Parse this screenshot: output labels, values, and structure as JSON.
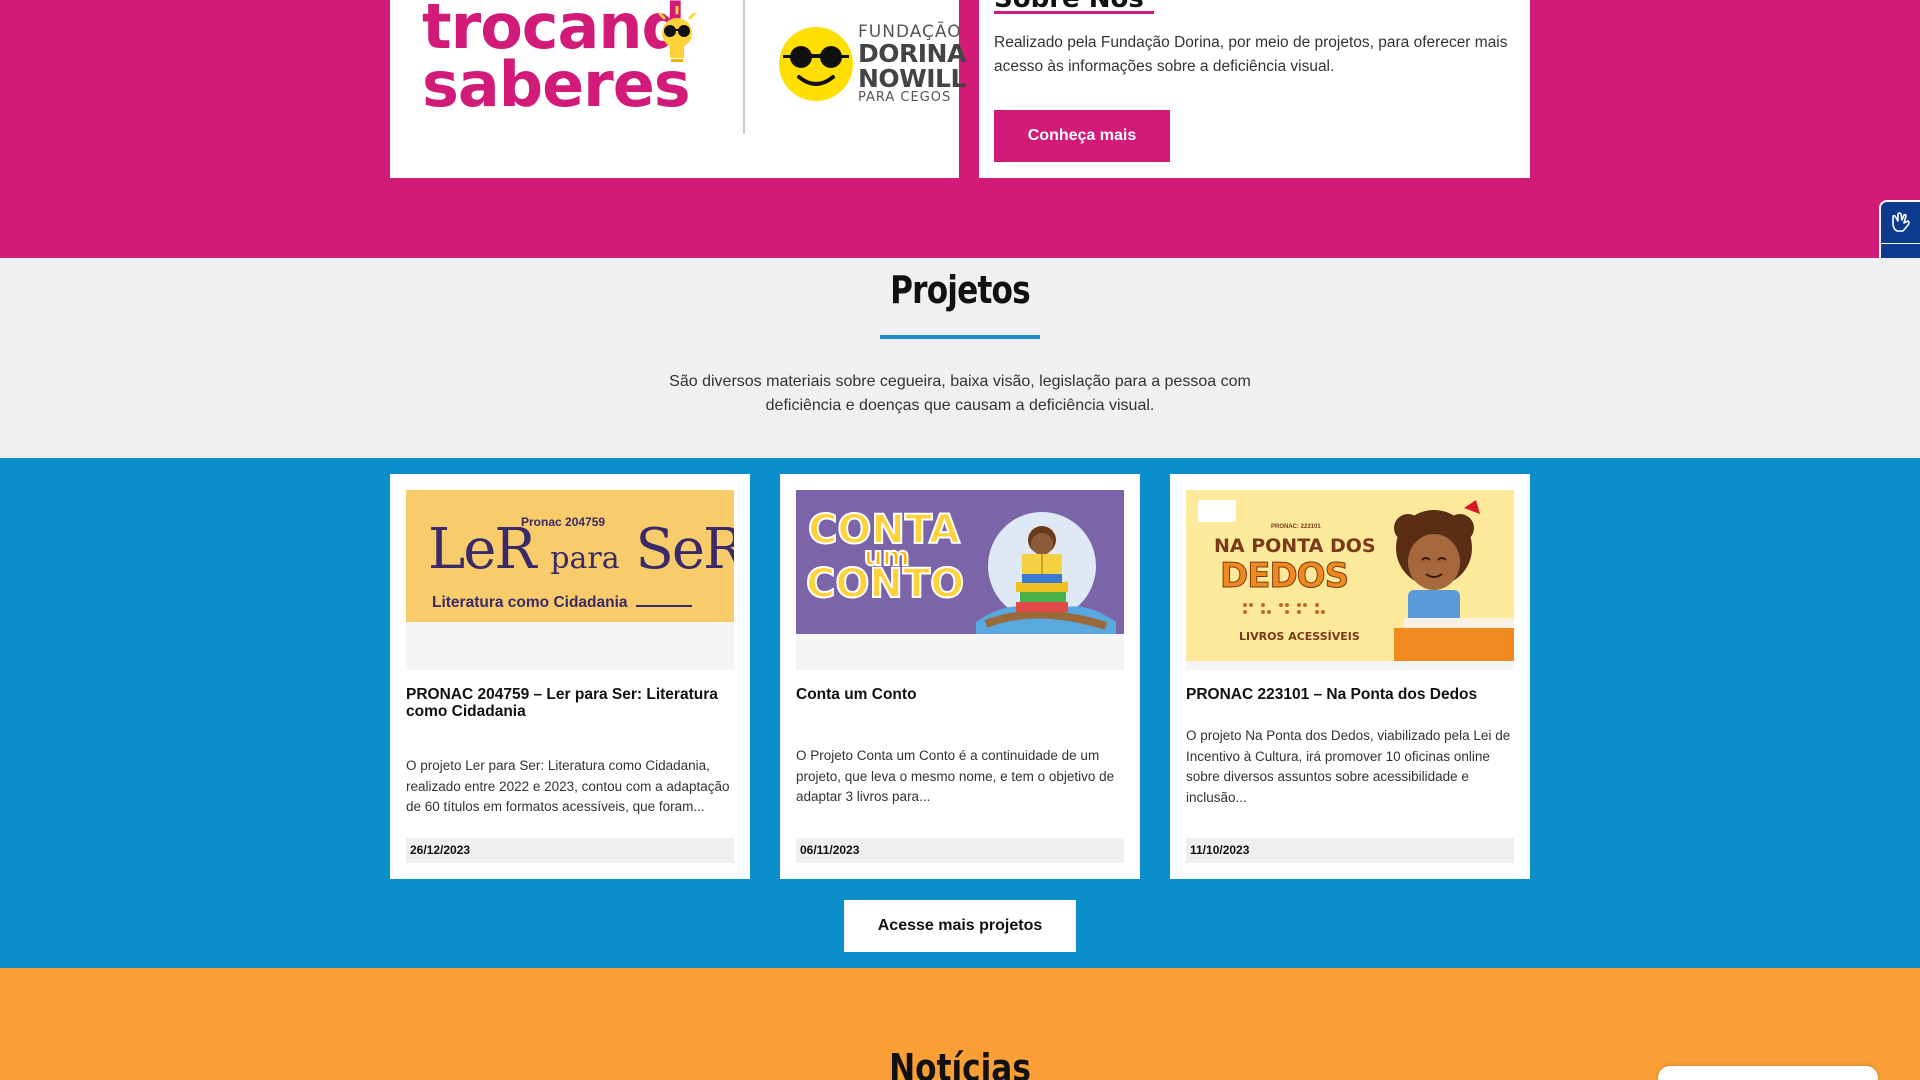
{
  "about": {
    "logo_line1": "trocand",
    "logo_line2": "saberes",
    "dorina_line1": "FUNDAÇÃO",
    "dorina_line2": "DORINA",
    "dorina_line3": "NOWILL",
    "dorina_line4": "PARA CEGOS",
    "title": "Sobre Nós",
    "text": "Realizado pela Fundação Dorina, por meio de projetos, para oferecer mais acesso às informações sobre a deficiência visual.",
    "button_label": "Conheça mais"
  },
  "accessibility": {
    "sign_language_icon": "sign-language-hand-icon",
    "visual_icon": "eye-icon"
  },
  "projects": {
    "title": "Projetos",
    "description": "São diversos materiais sobre cegueira, baixa visão, legislação para a pessoa com deficiência e doenças que causam a deficiência visual.",
    "more_button": "Acesse mais projetos",
    "cards": [
      {
        "image_pronac": "Pronac 204759",
        "image_word1": "LeR",
        "image_word2": "para",
        "image_word3": "SeR",
        "image_subtitle": "Literatura como Cidadania",
        "title": "PRONAC 204759 – Ler para Ser: Literatura como Cidadania",
        "text": "O projeto Ler para Ser: Literatura como Cidadania, realizado entre 2022 e 2023, contou com a adaptação de 60 títulos em formatos acessíveis, que foram...",
        "date": "26/12/2023"
      },
      {
        "image_word1": "CONTA",
        "image_word2": "um",
        "image_word3": "CONTO",
        "title": "Conta um Conto",
        "text": "O Projeto Conta um Conto é a continuidade de um projeto, que leva o mesmo nome, e tem o objetivo de adaptar 3 livros para...",
        "date": "06/11/2023"
      },
      {
        "image_pronac": "PRONAC: 223101",
        "image_word1": "NA PONTA DOS",
        "image_word2": "DEDOS",
        "image_word3": "LIVROS ACESSÍVEIS",
        "title": "PRONAC 223101 – Na Ponta dos Dedos",
        "text": "O projeto Na Ponta dos Dedos, viabilizado pela Lei de Incentivo à Cultura, irá promover 10 oficinas online sobre diversos assuntos sobre acessibilidade e inclusão...",
        "date": "11/10/2023"
      }
    ]
  },
  "news": {
    "title": "Notícias"
  },
  "colors": {
    "magenta": "#d21a78",
    "blue": "#0a8fcb",
    "orange": "#f99f36",
    "navy": "#0c3a8c"
  }
}
